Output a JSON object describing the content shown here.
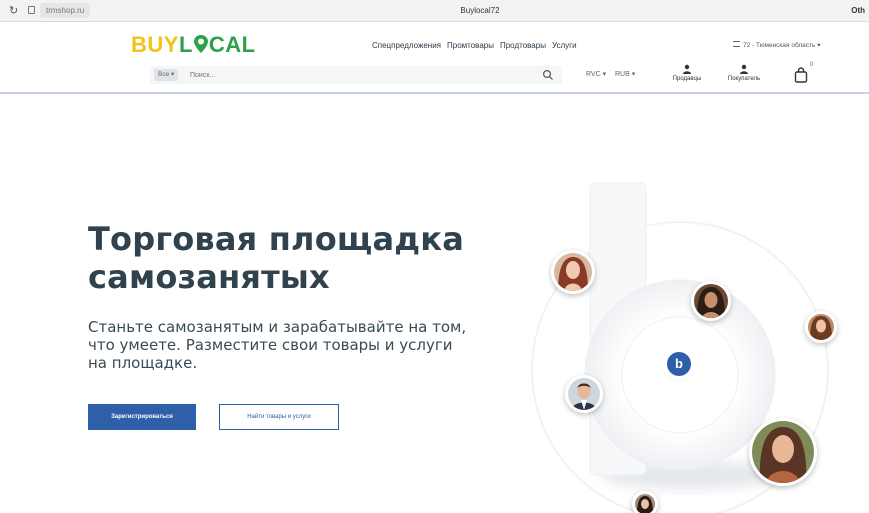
{
  "browser": {
    "url": "trmshop.ru",
    "tab_title": "Buylocal72",
    "right_control": "Oth"
  },
  "header": {
    "logo_text": {
      "buy": "BUY",
      "lo": "L",
      "cal": "CAL"
    },
    "nav": [
      "Спецпредложения",
      "Промтовары",
      "Продтовары",
      "Услуги"
    ],
    "region": "72 - Тюменская область",
    "search": {
      "category": "Все",
      "placeholder": "Поиск..."
    },
    "currency_1": "RVC",
    "currency_2": "RUB",
    "sellers_label": "Продавцы",
    "buyers_label": "Покупатель",
    "cart_count": "0"
  },
  "hero": {
    "title_line1": "Торговая площадка",
    "title_line2": "самозанятых",
    "subtitle": "Станьте самозанятым и зарабатывайте на том, что умеете. Разместите свои товары и услуги на площадке.",
    "register_button": "Зарегистрироваться",
    "find_button": "Найти товары и услуги",
    "badge_letter": "b"
  },
  "colors": {
    "brand_yellow": "#f2c31a",
    "brand_green": "#2ea04a",
    "primary_blue": "#2e5fa8",
    "heading": "#2f424d"
  }
}
